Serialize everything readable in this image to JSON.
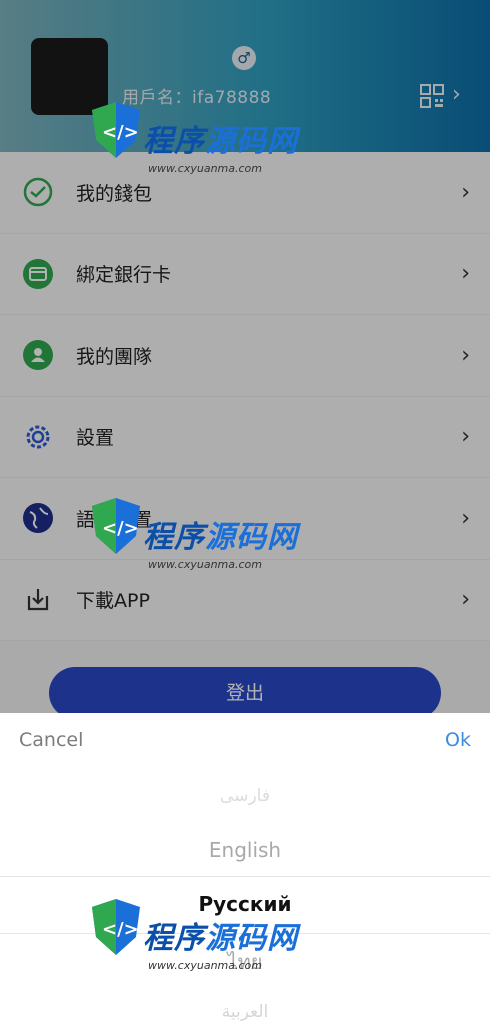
{
  "profile": {
    "username": "用戶名：ifa78888",
    "gender_icon": "male-icon"
  },
  "menu": [
    {
      "label": "我的錢包",
      "icon": "wallet-icon",
      "color": "#2fa84f"
    },
    {
      "label": "綁定銀行卡",
      "icon": "bank-card-icon",
      "color": "#2fa84f"
    },
    {
      "label": "我的團隊",
      "icon": "team-icon",
      "color": "#2fa84f"
    },
    {
      "label": "設置",
      "icon": "gear-icon",
      "color": "#2a5bd7"
    },
    {
      "label": "語言設置",
      "icon": "globe-icon",
      "color": "#1d2f8c"
    },
    {
      "label": "下載APP",
      "icon": "download-icon",
      "color": "#333333"
    }
  ],
  "logout_label": "登出",
  "picker": {
    "cancel": "Cancel",
    "ok": "Ok",
    "options": [
      "فارسی",
      "English",
      "Русский",
      "ไทย",
      "العربية"
    ]
  },
  "watermark": {
    "title_a": "程序",
    "title_b": "源码网",
    "url": "www.cxyuanma.com"
  }
}
